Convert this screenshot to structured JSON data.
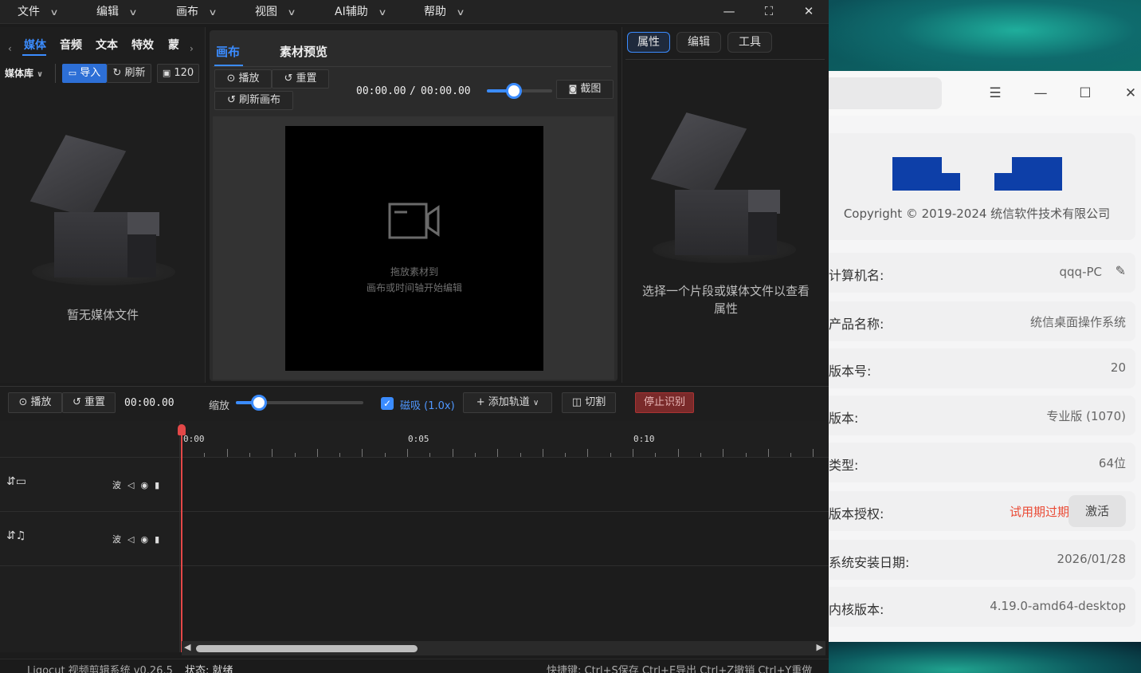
{
  "menu": {
    "items": [
      {
        "label": "文件"
      },
      {
        "label": "编辑"
      },
      {
        "label": "画布"
      },
      {
        "label": "视图"
      },
      {
        "label": "AI辅助"
      },
      {
        "label": "帮助"
      }
    ]
  },
  "media_panel": {
    "tabs": [
      "媒体",
      "音频",
      "文本",
      "特效",
      "蒙"
    ],
    "library_select": "媒体库",
    "import_label": "导入",
    "refresh_label": "刷新",
    "size_value": "120",
    "empty_text": "暂无媒体文件"
  },
  "canvas_panel": {
    "tabs": [
      "画布",
      "素材预览"
    ],
    "play_label": "播放",
    "reset_label": "重置",
    "refresh_canvas_label": "刷新画布",
    "time_current": "00:00.00",
    "time_separator": "/",
    "time_total": "00:00.00",
    "zoom_fraction": 0.42,
    "screenshot_label": "截图",
    "hint_line1": "拖放素材到",
    "hint_line2": "画布或时间轴开始编辑"
  },
  "props_panel": {
    "tabs": [
      "属性",
      "编辑",
      "工具"
    ],
    "empty_text_line1": "选择一个片段或媒体文件以查看",
    "empty_text_line2": "属性"
  },
  "timeline": {
    "play_label": "播放",
    "reset_label": "重置",
    "time": "00:00.00",
    "zoom_label": "缩放",
    "zoom_fraction": 0.18,
    "snap_label": "磁吸 (1.0x)",
    "add_track_label": "添加轨道",
    "cut_label": "切割",
    "stop_label": "停止识别",
    "ruler_labels": [
      "0:00",
      "0:05",
      "0:10"
    ],
    "track_control_label": "波"
  },
  "status": {
    "app_name": "Ligocut 视频剪辑系统 v0.26.5",
    "state": "状态: 就绪",
    "shortcuts": "快捷键: Ctrl+S保存 Ctrl+E导出 Ctrl+Z撤销 Ctrl+Y重做"
  },
  "sysinfo": {
    "copyright": "Copyright © 2019-2024 统信软件技术有限公司",
    "rows": [
      {
        "label": "计算机名:",
        "value": "qqq-PC"
      },
      {
        "label": "产品名称:",
        "value": "统信桌面操作系统"
      },
      {
        "label": "版本号:",
        "value": "20"
      },
      {
        "label": "版本:",
        "value": "专业版 (1070)"
      },
      {
        "label": "类型:",
        "value": "64位"
      },
      {
        "label": "版本授权:",
        "value": "试用期过期"
      },
      {
        "label": "系统安装日期:",
        "value": "2026/01/28"
      },
      {
        "label": "内核版本:",
        "value": "4.19.0-amd64-desktop"
      }
    ],
    "activate_label": "激活",
    "brand_color": "#0d3fa8",
    "warning_color": "#ea4b36"
  },
  "colors": {
    "accent": "#3b8cff",
    "playhead": "#e34848"
  }
}
